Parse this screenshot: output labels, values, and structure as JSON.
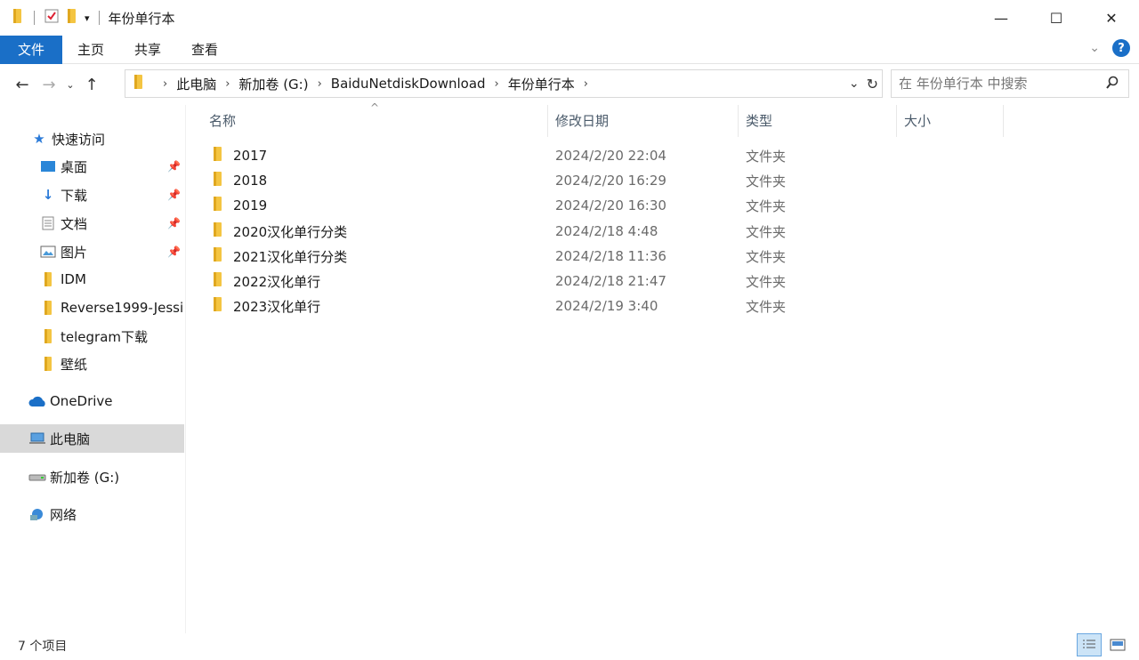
{
  "window": {
    "title": "年份单行本",
    "min": "—",
    "max": "☐",
    "close": "✕"
  },
  "ribbon": {
    "tabs": [
      "文件",
      "主页",
      "共享",
      "查看"
    ]
  },
  "address": {
    "crumbs": [
      "此电脑",
      "新加卷 (G:)",
      "BaiduNetdiskDownload",
      "年份单行本"
    ]
  },
  "search": {
    "placeholder": "在 年份单行本 中搜索"
  },
  "sidebar": {
    "quick_access": "快速访问",
    "items": [
      "桌面",
      "下载",
      "文档",
      "图片",
      "IDM",
      "Reverse1999-Jessi",
      "telegram下载",
      "壁纸"
    ],
    "onedrive": "OneDrive",
    "this_pc": "此电脑",
    "drive": "新加卷 (G:)",
    "network": "网络"
  },
  "columns": {
    "name": "名称",
    "date": "修改日期",
    "type": "类型",
    "size": "大小"
  },
  "files": [
    {
      "name": "2017",
      "date": "2024/2/20 22:04",
      "type": "文件夹"
    },
    {
      "name": "2018",
      "date": "2024/2/20 16:29",
      "type": "文件夹"
    },
    {
      "name": "2019",
      "date": "2024/2/20 16:30",
      "type": "文件夹"
    },
    {
      "name": "2020汉化单行分类",
      "date": "2024/2/18 4:48",
      "type": "文件夹"
    },
    {
      "name": "2021汉化单行分类",
      "date": "2024/2/18 11:36",
      "type": "文件夹"
    },
    {
      "name": "2022汉化单行",
      "date": "2024/2/18 21:47",
      "type": "文件夹"
    },
    {
      "name": "2023汉化单行",
      "date": "2024/2/19 3:40",
      "type": "文件夹"
    }
  ],
  "status": {
    "count": "7 个项目"
  },
  "colors": {
    "accent": "#1a6fc7",
    "folder": "#f4c542",
    "selected": "#d9d9d9"
  }
}
